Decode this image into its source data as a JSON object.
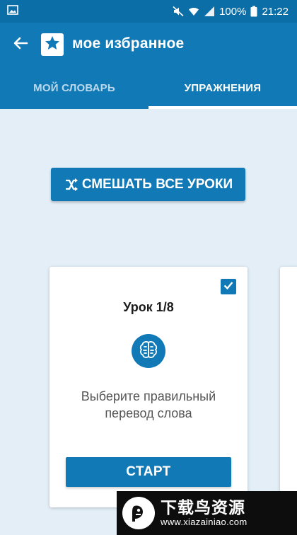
{
  "status_bar": {
    "battery": "100%",
    "time": "21:22"
  },
  "app_bar": {
    "title": "мое избранное",
    "back_icon": "arrow-left-icon",
    "logo_icon": "star-icon"
  },
  "tabs": [
    {
      "label": "МОЙ СЛОВАРЬ",
      "selected": false
    },
    {
      "label": "УПРАЖНЕНИЯ",
      "selected": true
    }
  ],
  "mix_button": {
    "label": "СМЕШАТЬ ВСЕ УРОКИ",
    "icon": "shuffle-icon"
  },
  "lesson_card": {
    "title": "Урок 1/8",
    "checked": true,
    "icon": "brain-icon",
    "description": "Выберите правильный перевод слова",
    "start_label": "СТАРТ"
  },
  "watermark": {
    "main": "下载鸟资源",
    "url": "www.xiazainiao.com"
  },
  "colors": {
    "primary": "#1079b6",
    "status_bar": "#0c6ea6",
    "background": "#e3eef7"
  }
}
